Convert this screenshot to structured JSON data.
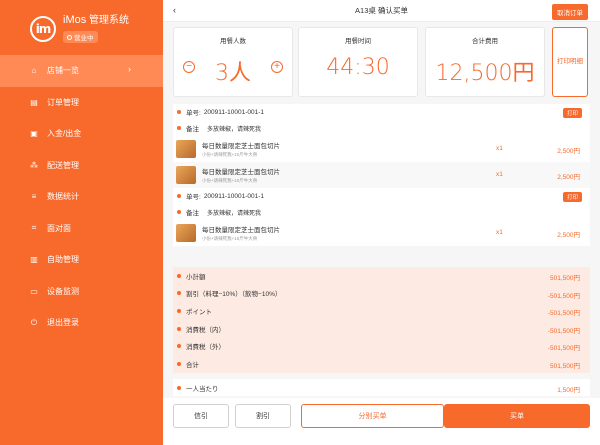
{
  "app": {
    "logo": "im",
    "name": "iMos",
    "subtitle": "管理系统",
    "status": "营业中"
  },
  "sidebar": {
    "items": [
      {
        "label": "店铺一览",
        "icon": "home-icon",
        "glyph": "⌂",
        "active": true
      },
      {
        "label": "订单管理",
        "icon": "document-icon",
        "glyph": "▤"
      },
      {
        "label": "入金/出金",
        "icon": "wallet-icon",
        "glyph": "▣"
      },
      {
        "label": "配送管理",
        "icon": "delivery-icon",
        "glyph": "⁂"
      },
      {
        "label": "数据统计",
        "icon": "stats-icon",
        "glyph": "≡"
      },
      {
        "label": "面对面",
        "icon": "scan-icon",
        "glyph": "⌗"
      },
      {
        "label": "自助管理",
        "icon": "self-service-icon",
        "glyph": "▥"
      },
      {
        "label": "设备监测",
        "icon": "monitor-icon",
        "glyph": "▭"
      },
      {
        "label": "退出登录",
        "icon": "logout-icon",
        "glyph": "⏻"
      }
    ]
  },
  "header": {
    "title": "A13桌 确认买单",
    "cancel": "取消订单"
  },
  "summary": {
    "guests_label": "用餐人数",
    "guests_value": "3人",
    "time_label": "用餐时间",
    "time_value": "44:30",
    "total_label": "合计费用",
    "total_value": "12,500円",
    "print_detail": "打印\n明细"
  },
  "orders": [
    {
      "number_label": "单号:",
      "number": "200911-10001-001-1",
      "print": "打印",
      "note_label": "备注",
      "note": "多放辣椒，请辣死我",
      "items": [
        {
          "name": "每日数量限定芝士面包切片",
          "desc": "小份+请辣死我+10斤牛大骨",
          "qty": "x1",
          "price": "2,500円"
        },
        {
          "name": "每日数量限定芝士面包切片",
          "desc": "小份+请辣死我+10斤牛大骨",
          "qty": "x1",
          "price": "2,500円"
        }
      ]
    },
    {
      "number_label": "单号:",
      "number": "200911-10001-001-1",
      "print": "打印",
      "note_label": "备注",
      "note": "多放辣椒，请辣死我",
      "items": [
        {
          "name": "每日数量限定芝士面包切片",
          "desc": "小份+请辣死我+10斤牛大骨",
          "qty": "x1",
          "price": "2,500円"
        }
      ]
    }
  ],
  "totals": [
    {
      "label": "小計額",
      "amount": "501,500円"
    },
    {
      "label": "割引（料理−10%）（飲物−10%）",
      "amount": "-501,500円"
    },
    {
      "label": "ポイント",
      "amount": "-501,500円"
    },
    {
      "label": "消費税（内）",
      "amount": "-501,500円"
    },
    {
      "label": "消費税（外）",
      "amount": "-501,500円"
    },
    {
      "label": "合计",
      "amount": "501,500円"
    }
  ],
  "per_person": {
    "label": "一人当たり",
    "amount": "1,500円"
  },
  "footer": {
    "credit": "信引",
    "discount": "割引",
    "split": "分别买单",
    "pay": "买单"
  },
  "colors": {
    "accent": "#f76a2c",
    "accent_light": "#ff8a55",
    "totals_bg": "#fdeae3"
  }
}
